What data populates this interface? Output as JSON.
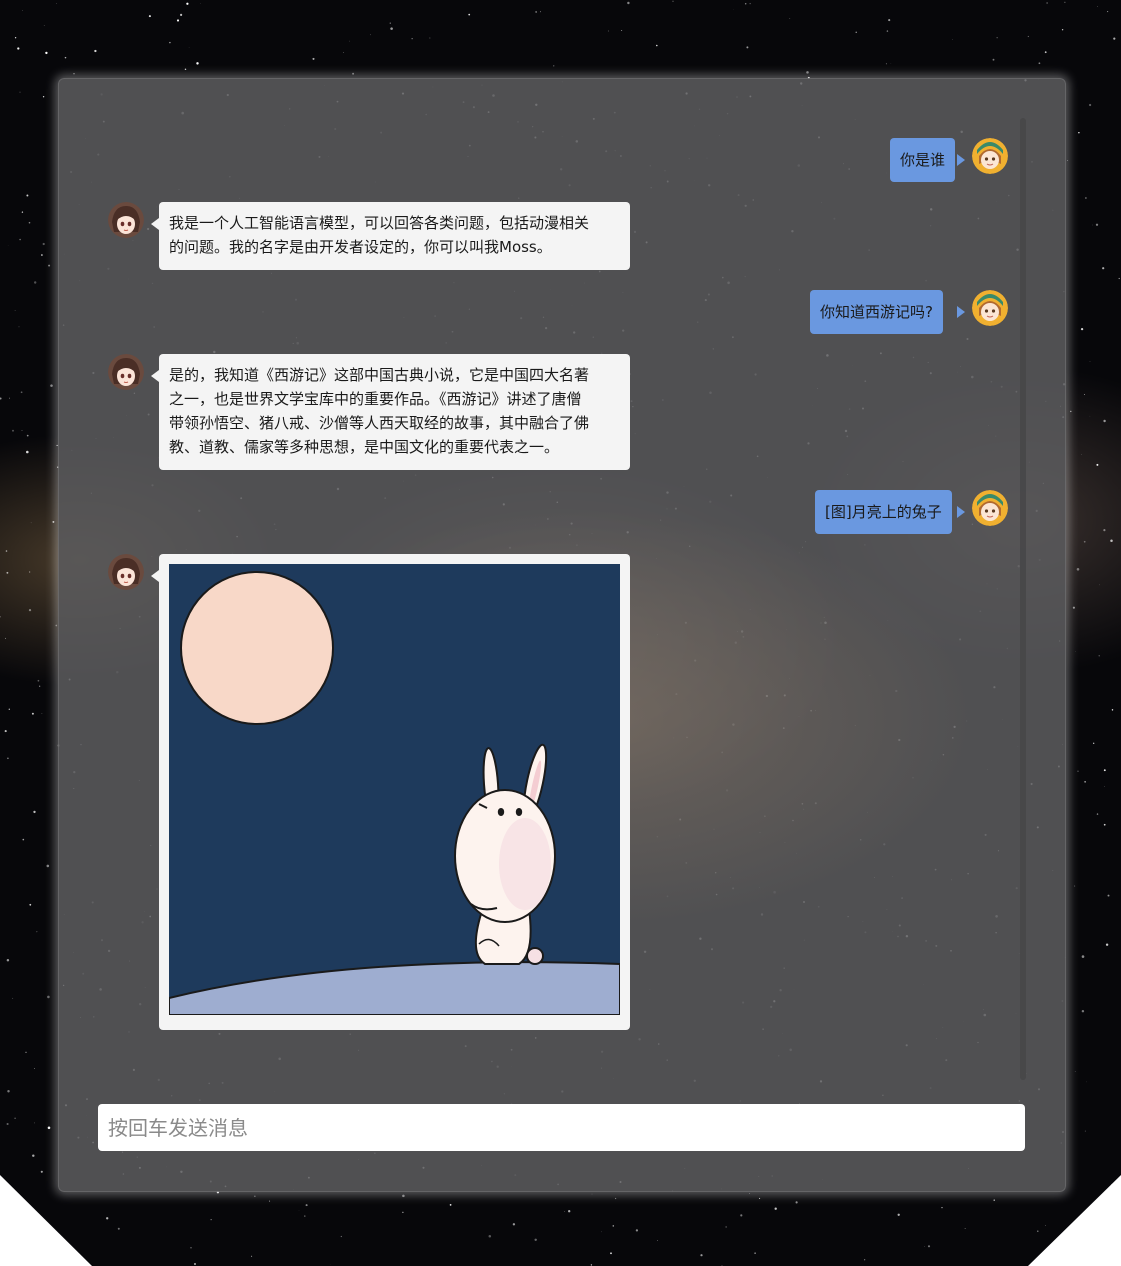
{
  "chat": {
    "messages": [
      {
        "role": "user",
        "text": "你是谁"
      },
      {
        "role": "assistant",
        "lines": [
          "我是一个人工智能语言模型，可以回答各类问题，包括动漫相关",
          "的问题。我的名字是由开发者设定的，你可以叫我Moss。"
        ]
      },
      {
        "role": "user",
        "text": "你知道西游记吗?"
      },
      {
        "role": "assistant",
        "lines": [
          "是的，我知道《西游记》这部中国古典小说，它是中国四大名著",
          "之一，也是世界文学宝库中的重要作品。《西游记》讲述了唐僧",
          "带领孙悟空、猪八戒、沙僧等人西天取经的故事，其中融合了佛",
          "教、道教、儒家等多种思想，是中国文化的重要代表之一。"
        ]
      },
      {
        "role": "user",
        "text": "[图]月亮上的兔子"
      },
      {
        "role": "assistant",
        "image": "moon-rabbit-illustration"
      }
    ]
  },
  "composer": {
    "placeholder": "按回车发送消息",
    "value": ""
  },
  "colors": {
    "user_bubble": "#6a98e0",
    "bot_bubble": "#f4f4f4",
    "panel": "#5c5c5e",
    "image_sky": "#1e3a5c",
    "image_moon": "#f8d8c8",
    "image_ground": "#9eadd0"
  }
}
